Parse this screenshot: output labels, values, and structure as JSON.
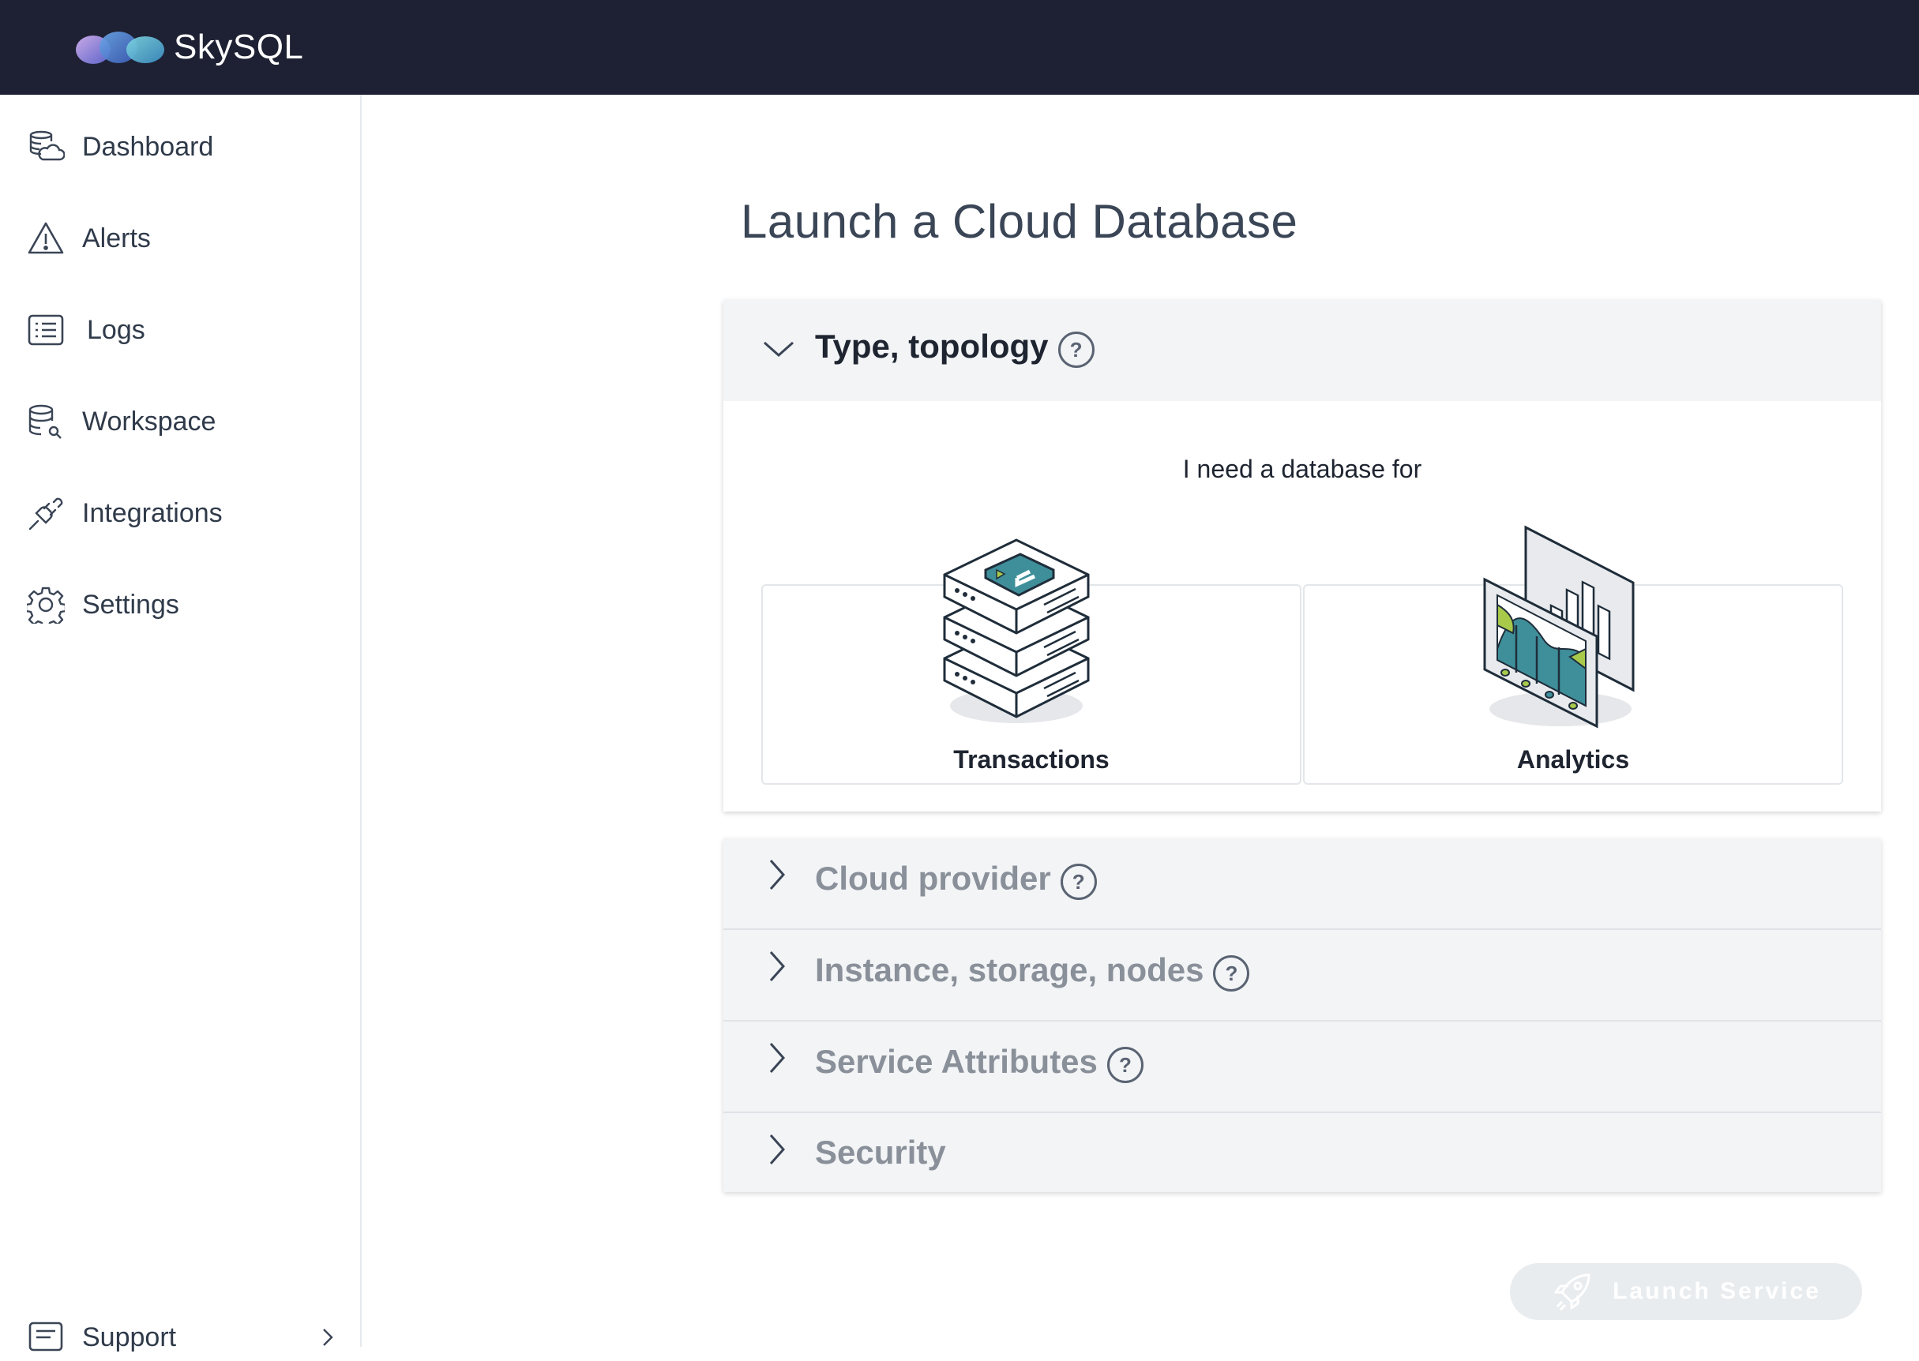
{
  "header": {
    "brand": "SkySQL",
    "logo_icon": "skysql-cloud-logo",
    "background": "#1e2133"
  },
  "sidebar": {
    "items": [
      {
        "label": "Dashboard",
        "icon": "dashboard-icon"
      },
      {
        "label": "Alerts",
        "icon": "alert-triangle-icon"
      },
      {
        "label": "Logs",
        "icon": "logs-list-icon"
      },
      {
        "label": "Workspace",
        "icon": "database-search-icon"
      },
      {
        "label": "Integrations",
        "icon": "plug-icon"
      },
      {
        "label": "Settings",
        "icon": "gear-icon"
      }
    ],
    "support": {
      "label": "Support",
      "icon": "support-icon"
    }
  },
  "main": {
    "title": "Launch a Cloud Database",
    "type_topology": {
      "title": "Type, topology",
      "help": "?",
      "prompt": "I need a database for",
      "options": [
        {
          "label": "Transactions",
          "illustration": "server-stack-illustration"
        },
        {
          "label": "Analytics",
          "illustration": "analytics-charts-illustration"
        }
      ]
    },
    "sections": [
      {
        "title": "Cloud provider",
        "help": "?"
      },
      {
        "title": "Instance, storage, nodes",
        "help": "?"
      },
      {
        "title": "Service Attributes",
        "help": "?"
      },
      {
        "title": "Security",
        "help": ""
      }
    ],
    "launch_button": "Launch Service"
  },
  "colors": {
    "topbar": "#1e2133",
    "accent_teal": "#3f8f9a",
    "accent_green": "#a8c94a",
    "panel_header": "#f2f4f6",
    "disabled_button": "#e9ecef"
  }
}
